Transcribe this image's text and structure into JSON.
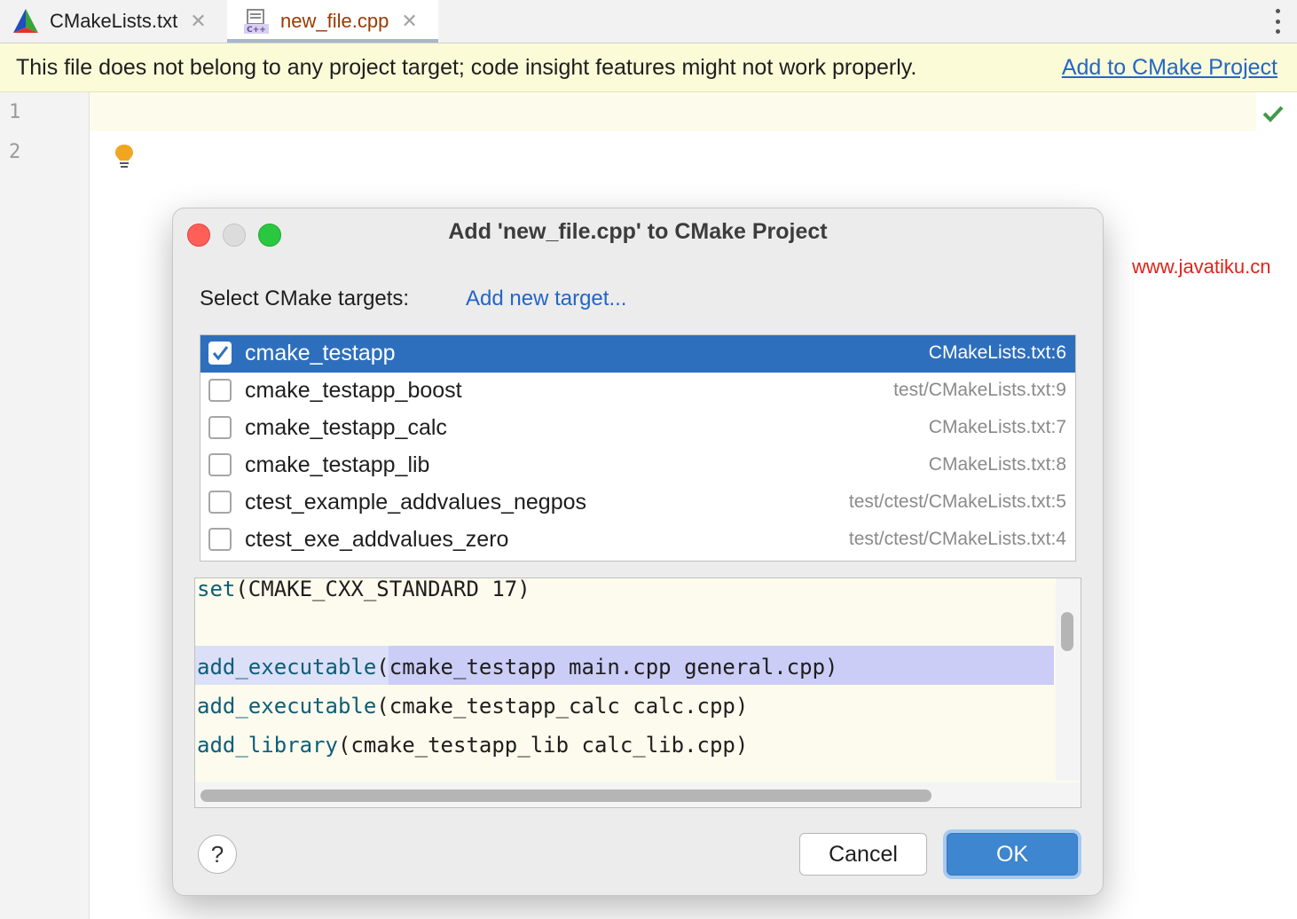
{
  "tabs": [
    {
      "label": "CMakeLists.txt",
      "close": "✕",
      "active": false,
      "icon": "cmake-icon"
    },
    {
      "label": "new_file.cpp",
      "close": "✕",
      "active": true,
      "icon": "cpp-file-icon",
      "icon_text": "C++"
    }
  ],
  "banner": {
    "message": "This file does not belong to any project target; code insight features might not work properly.",
    "link": "Add to CMake Project"
  },
  "editor": {
    "line_numbers": [
      "1",
      "2"
    ]
  },
  "watermark": "www.javatiku.cn",
  "dialog": {
    "title": "Add 'new_file.cpp' to CMake Project",
    "select_label": "Select CMake targets:",
    "add_target_link": "Add new target...",
    "targets": [
      {
        "name": "cmake_testapp",
        "location": "CMakeLists.txt:6",
        "checked": true,
        "selected": true
      },
      {
        "name": "cmake_testapp_boost",
        "location": "test/CMakeLists.txt:9",
        "checked": false,
        "selected": false
      },
      {
        "name": "cmake_testapp_calc",
        "location": "CMakeLists.txt:7",
        "checked": false,
        "selected": false
      },
      {
        "name": "cmake_testapp_lib",
        "location": "CMakeLists.txt:8",
        "checked": false,
        "selected": false
      },
      {
        "name": "ctest_example_addvalues_negpos",
        "location": "test/ctest/CMakeLists.txt:5",
        "checked": false,
        "selected": false
      },
      {
        "name": "ctest_exe_addvalues_zero",
        "location": "test/ctest/CMakeLists.txt:4",
        "checked": false,
        "selected": false
      }
    ],
    "code_lines": [
      {
        "kw": "set",
        "rest": "(CMAKE_CXX_STANDARD 17)"
      },
      {
        "kw": "",
        "rest": ""
      },
      {
        "kw": "add_executable",
        "rest": "(cmake_testapp main.cpp general.cpp)"
      },
      {
        "kw": "add_executable",
        "rest": "(cmake_testapp_calc calc.cpp)"
      },
      {
        "kw": "add_library",
        "rest": "(cmake_testapp_lib calc_lib.cpp)"
      }
    ],
    "help_label": "?",
    "cancel_label": "Cancel",
    "ok_label": "OK"
  },
  "colors": {
    "accent": "#2e6fbd",
    "link": "#2366c6",
    "banner_bg": "#fbfbd8",
    "keyword": "#0d5e78",
    "highlight": "#cbcdf7",
    "ok_button": "#3e86cf"
  }
}
